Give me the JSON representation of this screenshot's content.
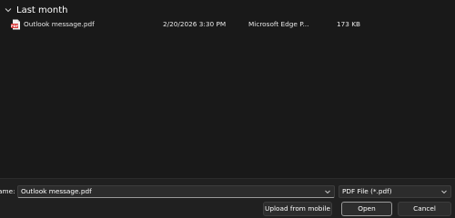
{
  "file_list": {
    "group": {
      "label": "Last month",
      "icon": "chevron-down-icon"
    },
    "files": [
      {
        "name": "Outlook message.pdf",
        "date_modified": "2/20/2026 3:30 PM",
        "type": "Microsoft Edge P...",
        "size": "173 KB",
        "icon": "pdf-file-icon"
      }
    ]
  },
  "footer": {
    "filename_label": "ame:",
    "filename_value": "Outlook message.pdf",
    "filetype_value": "PDF File (*.pdf)",
    "upload_label": "Upload from mobile",
    "open_label": "Open",
    "cancel_label": "Cancel"
  },
  "colors": {
    "background": "#191919",
    "footer_background": "#202020",
    "pdf_icon": "#d83b3b",
    "text": "#ffffff"
  }
}
